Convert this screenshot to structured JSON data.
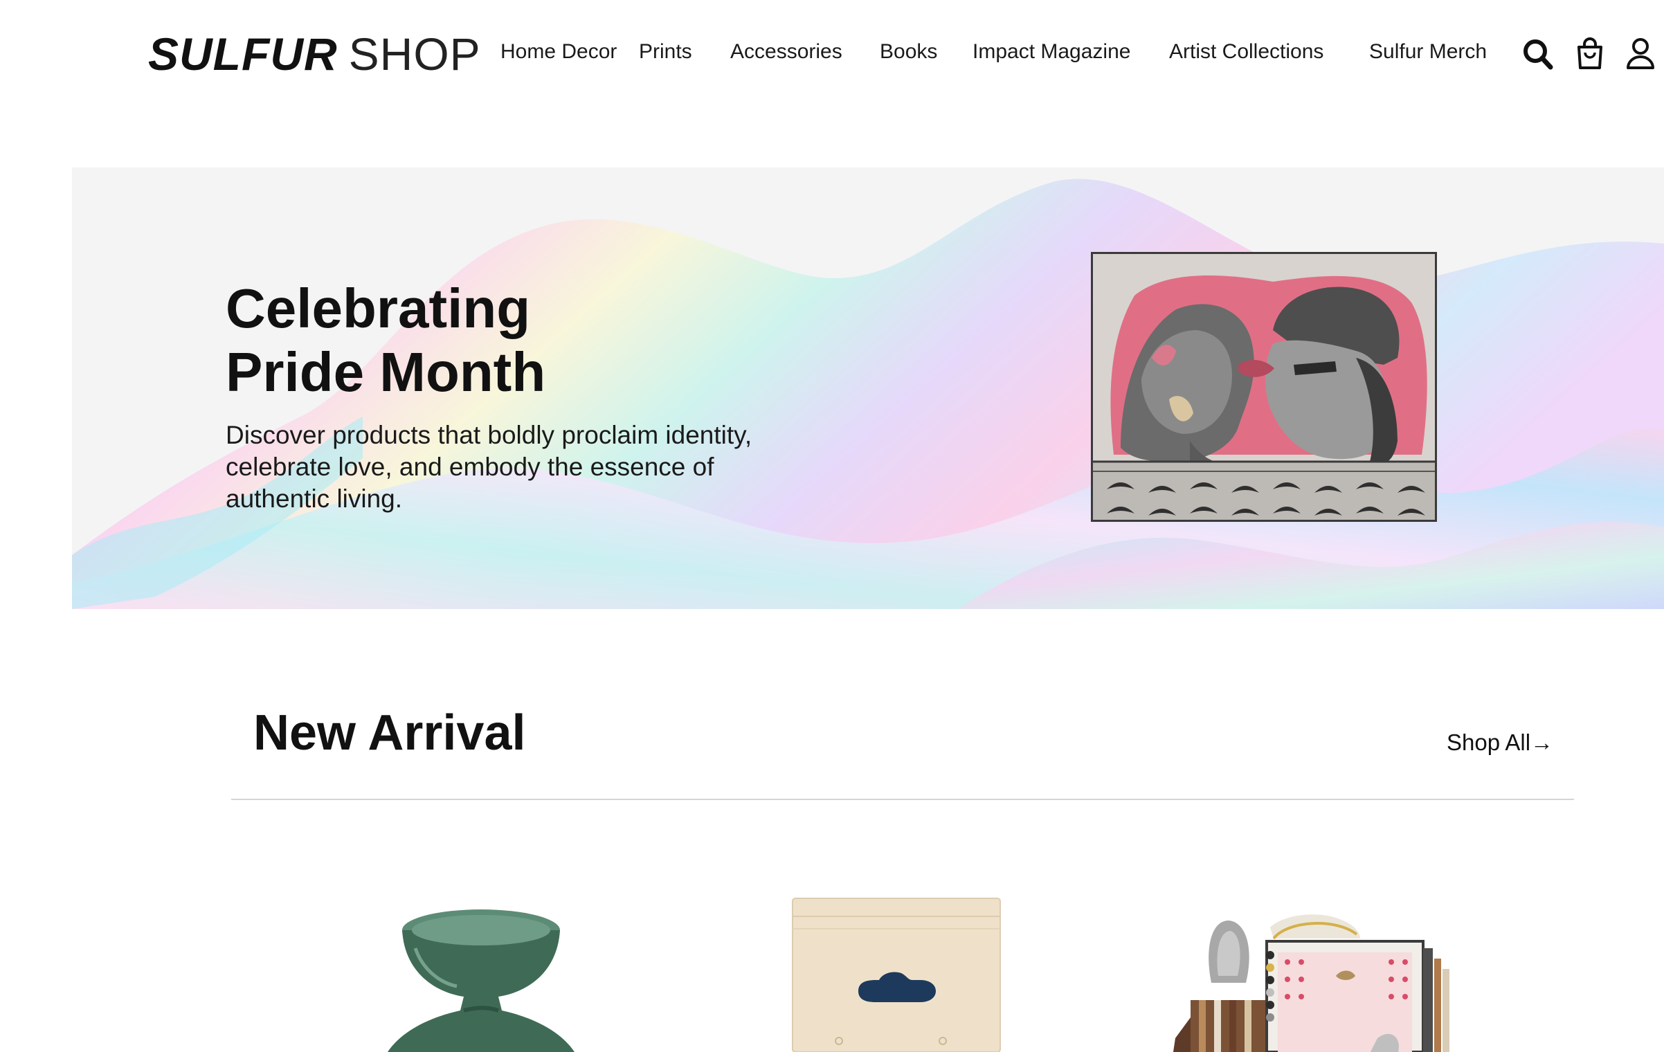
{
  "header": {
    "logo_bold": "SULFUR",
    "logo_light": "SHOP",
    "nav": [
      "Home Decor",
      "Prints",
      "Accessories",
      "Books",
      "Impact Magazine",
      "Artist Collections",
      "Sulfur Merch"
    ],
    "icons": [
      "search-icon",
      "shopping-bag-icon",
      "user-account-icon"
    ]
  },
  "hero": {
    "title_line1": "Celebrating",
    "title_line2": "Pride Month",
    "desc_line1": "Discover products that boldly proclaim identity,",
    "desc_line2": "celebrate love, and embody the essence of",
    "desc_line3": "authentic living."
  },
  "new_arrival": {
    "title": "New Arrival",
    "shop_all": "Shop All→"
  },
  "colors": {
    "text": "#111111",
    "hero_bg": "#f4f4f5",
    "divider": "#d6d6d6",
    "vase_green": "#3f6b56",
    "box_beige": "#efe1c9",
    "box_handle": "#1d3a5c"
  }
}
